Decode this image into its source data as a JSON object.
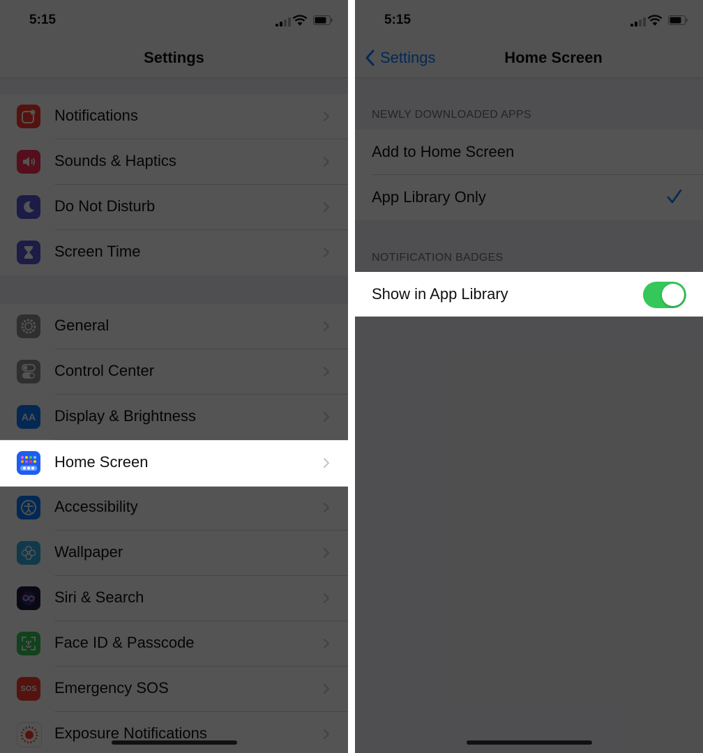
{
  "status_bar": {
    "time": "5:15"
  },
  "left_screen": {
    "nav_title": "Settings",
    "groups": [
      [
        {
          "label": "Notifications",
          "icon": "notifications-icon",
          "color": "#ff3b30"
        },
        {
          "label": "Sounds & Haptics",
          "icon": "speaker-icon",
          "color": "#ff2d55"
        },
        {
          "label": "Do Not Disturb",
          "icon": "moon-icon",
          "color": "#5856d6"
        },
        {
          "label": "Screen Time",
          "icon": "hourglass-icon",
          "color": "#5856d6"
        }
      ],
      [
        {
          "label": "General",
          "icon": "gear-icon",
          "color": "#8e8e93"
        },
        {
          "label": "Control Center",
          "icon": "toggles-icon",
          "color": "#8e8e93"
        },
        {
          "label": "Display & Brightness",
          "icon": "text-size-icon",
          "color": "#0a7aff",
          "glyph": "AA"
        },
        {
          "label": "Home Screen",
          "icon": "home-screen-grid-icon",
          "color": "#1f5cf0",
          "highlighted": true
        },
        {
          "label": "Accessibility",
          "icon": "accessibility-icon",
          "color": "#0a7aff"
        },
        {
          "label": "Wallpaper",
          "icon": "flower-icon",
          "color": "#32ade6"
        },
        {
          "label": "Siri & Search",
          "icon": "siri-icon",
          "color": "#1c1c3a"
        },
        {
          "label": "Face ID & Passcode",
          "icon": "face-id-icon",
          "color": "#34c759"
        },
        {
          "label": "Emergency SOS",
          "icon": "sos-icon",
          "color": "#ff3b30",
          "glyph": "SOS"
        },
        {
          "label": "Exposure Notifications",
          "icon": "exposure-icon",
          "color": "#ffffff"
        }
      ]
    ]
  },
  "right_screen": {
    "back_label": "Settings",
    "nav_title": "Home Screen",
    "section_newly": "NEWLY DOWNLOADED APPS",
    "option_add": "Add to Home Screen",
    "option_library": "App Library Only",
    "selected_option": "App Library Only",
    "section_badges": "NOTIFICATION BADGES",
    "show_in_library": "Show in App Library",
    "show_in_library_on": true
  },
  "colors": {
    "accent": "#0a7aff",
    "toggle_on": "#34c759"
  }
}
